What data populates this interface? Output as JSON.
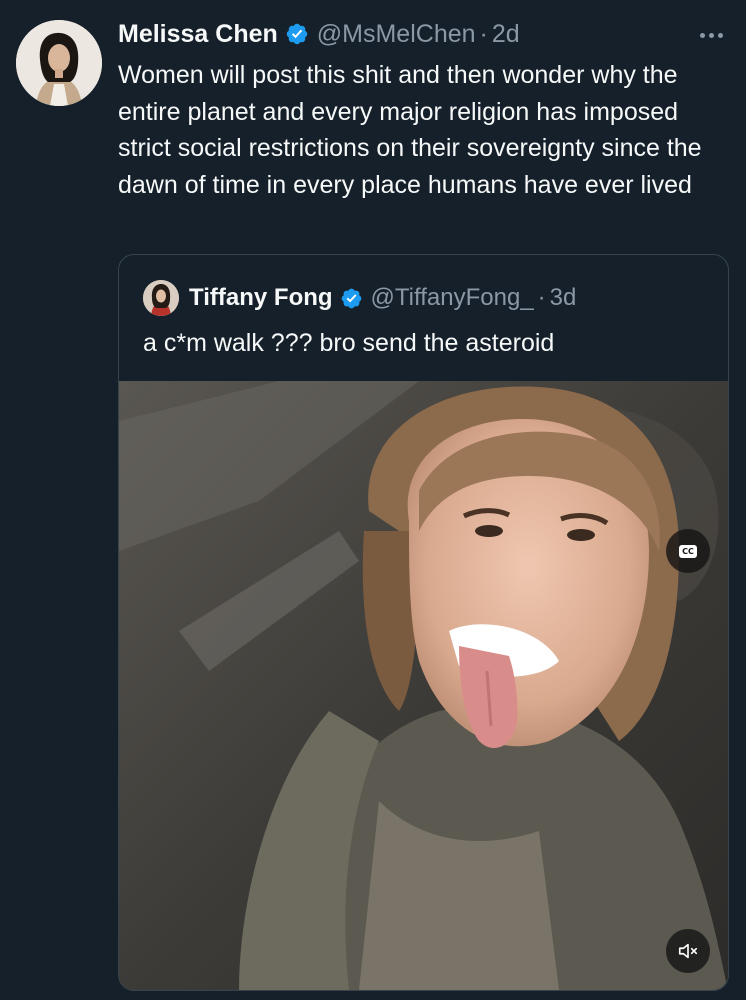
{
  "tweet": {
    "author": {
      "display_name": "Melissa Chen",
      "handle": "@MsMelChen",
      "separator": "·",
      "time": "2d",
      "verified": true
    },
    "text": "Women will post this shit and then wonder why the entire planet and every major religion has imposed strict social restrictions on their sovereignty since the dawn of time in every place humans have ever lived",
    "more_icon": "more-horizontal-icon"
  },
  "quoted_tweet": {
    "author": {
      "display_name": "Tiffany Fong",
      "handle": "@TiffanyFong_",
      "separator": "·",
      "time": "3d",
      "verified": true
    },
    "text": "a c*m walk ??? bro send the asteroid",
    "media": {
      "type": "video",
      "captions_label": "CC",
      "captions_icon": "closed-captions-icon",
      "mute_icon": "speaker-muted-icon"
    }
  },
  "colors": {
    "background": "#15202b",
    "text_primary": "#f7f9f9",
    "text_secondary": "#8b98a5",
    "verified_badge": "#1d9bf0",
    "border": "#38444d"
  }
}
